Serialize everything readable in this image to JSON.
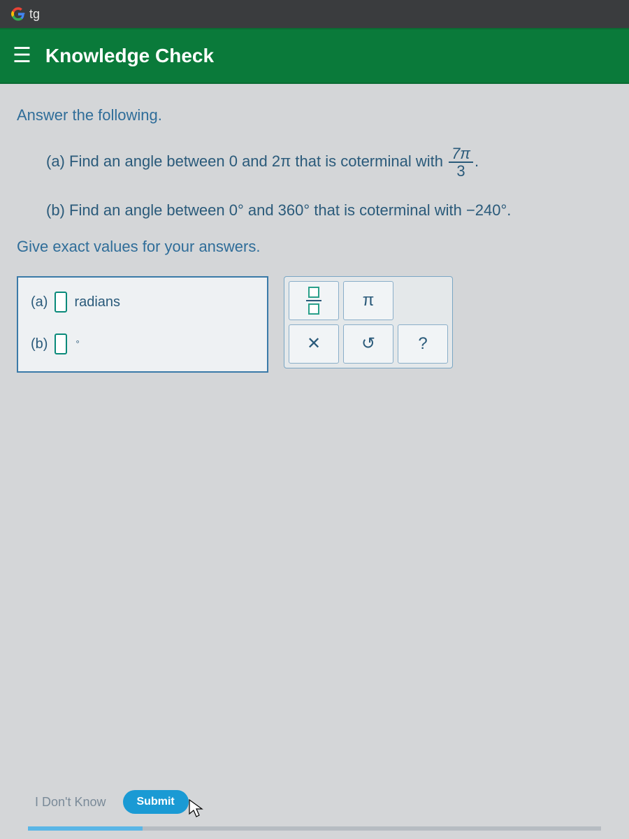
{
  "colors": {
    "header": "#0a7a3a",
    "accent": "#1a9ad4",
    "text": "#2a5a7a"
  },
  "browser": {
    "tab_label": "tg"
  },
  "header": {
    "title": "Knowledge Check"
  },
  "question": {
    "prompt": "Answer the following.",
    "part_a_prefix": "(a) Find an angle between 0 and 2π that is coterminal with ",
    "part_a_frac_num": "7π",
    "part_a_frac_den": "3",
    "part_a_suffix": ".",
    "part_b": "(b) Find an angle between 0° and 360° that is coterminal with −240°.",
    "instructions": "Give exact values for your answers."
  },
  "answers": {
    "a_label": "(a)",
    "a_unit": "radians",
    "b_label": "(b)",
    "b_unit": "°"
  },
  "toolbar": {
    "pi": "π",
    "clear": "✕",
    "undo": "↺",
    "help": "?"
  },
  "footer": {
    "dont_know": "I Don't Know",
    "submit": "Submit"
  }
}
